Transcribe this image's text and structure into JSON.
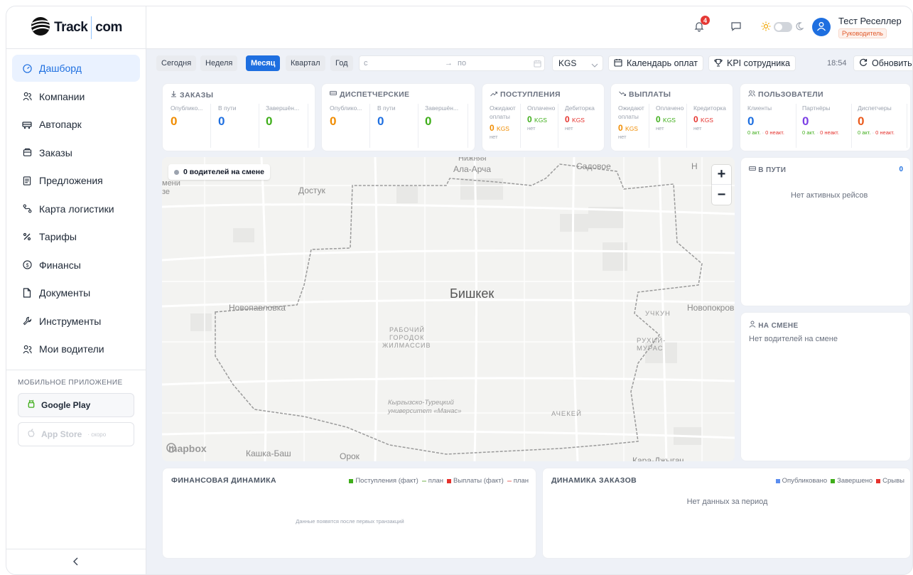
{
  "brand": {
    "logo_left": "Track",
    "logo_right": "com"
  },
  "sidebar": {
    "items": [
      {
        "label": "Дашборд",
        "icon": "gauge-icon",
        "active": true
      },
      {
        "label": "Компании",
        "icon": "users-icon",
        "active": false
      },
      {
        "label": "Автопарк",
        "icon": "truck-icon",
        "active": false
      },
      {
        "label": "Заказы",
        "icon": "box-icon",
        "active": false
      },
      {
        "label": "Предложения",
        "icon": "document-list-icon",
        "active": false
      },
      {
        "label": "Карта логистики",
        "icon": "route-icon",
        "active": false
      },
      {
        "label": "Тарифы",
        "icon": "percent-icon",
        "active": false
      },
      {
        "label": "Финансы",
        "icon": "dollar-circle-icon",
        "active": false
      },
      {
        "label": "Документы",
        "icon": "file-icon",
        "active": false
      },
      {
        "label": "Инструменты",
        "icon": "wrench-icon",
        "active": false
      },
      {
        "label": "Мои водители",
        "icon": "drivers-icon",
        "active": false
      }
    ],
    "mobile_title": "МОБИЛЬНОЕ ПРИЛОЖЕНИЕ",
    "google_play": "Google Play",
    "app_store": "App Store",
    "app_store_soon": "· скоро"
  },
  "header": {
    "notifications_count": "4",
    "user_name": "Тест Реселлер",
    "user_role": "Руководитель"
  },
  "toolbar": {
    "periods": [
      "Сегодня",
      "Неделя",
      "Месяц",
      "Квартал",
      "Год"
    ],
    "active_period": "Месяц",
    "date_from_placeholder": "с",
    "date_to_placeholder": "по",
    "arrow": "→",
    "currency": "KGS",
    "payment_calendar": "Календарь оплат",
    "kpi": "KPI сотрудника",
    "time": "18:54",
    "refresh": "Обновить"
  },
  "stats": {
    "orders": {
      "title": "ЗАКАЗЫ",
      "cols": [
        {
          "label": "Опублико...",
          "value": "0"
        },
        {
          "label": "В пути",
          "value": "0"
        },
        {
          "label": "Завершён...",
          "value": "0"
        }
      ]
    },
    "dispatch": {
      "title": "ДИСПЕТЧЕРСКИЕ",
      "cols": [
        {
          "label": "Опублико...",
          "value": "0"
        },
        {
          "label": "В пути",
          "value": "0"
        },
        {
          "label": "Завершён...",
          "value": "0"
        }
      ]
    },
    "income": {
      "title": "ПОСТУПЛЕНИЯ",
      "cols": [
        {
          "label": "Ожидают",
          "label2": "оплаты",
          "value": "0",
          "cur": "KGS",
          "sub": "нет"
        },
        {
          "label": "Оплачено",
          "value": "0",
          "cur": "KGS",
          "sub": "нет"
        },
        {
          "label": "Дебиторка",
          "value": "0",
          "cur": "KGS",
          "sub": "нет"
        }
      ]
    },
    "payouts": {
      "title": "ВЫПЛАТЫ",
      "cols": [
        {
          "label": "Ожидают",
          "label2": "оплаты",
          "value": "0",
          "cur": "KGS",
          "sub": "нет"
        },
        {
          "label": "Оплачено",
          "value": "0",
          "cur": "KGS",
          "sub": "нет"
        },
        {
          "label": "Кредиторка",
          "value": "0",
          "cur": "KGS",
          "sub": "нет"
        }
      ]
    },
    "users": {
      "title": "ПОЛЬЗОВАТЕЛИ",
      "cols": [
        {
          "label": "Клиенты",
          "value": "0",
          "active": "0 акт.",
          "sep": " · ",
          "inactive": "0 неакт."
        },
        {
          "label": "Партнёры",
          "value": "0",
          "active": "0 акт.",
          "sep": " · ",
          "inactive": "0 неакт."
        },
        {
          "label": "Диспетчеры",
          "value": "0",
          "active": "0 акт.",
          "sep": " · ",
          "inactive": "0 неакт."
        }
      ]
    }
  },
  "map": {
    "drivers_on_shift": "0 водителей на смене",
    "zoom_in": "+",
    "zoom_out": "−",
    "attribution": "mapbox",
    "labels": {
      "city": "Бишкек",
      "l1": "Нижняя",
      "l2": "Ала-Арча",
      "l3": "Садовое",
      "l4": "Н",
      "l5": "Достук",
      "l6": "мени",
      "l7": "зе",
      "l8": "Новопавловка",
      "l9": "Новопокровка",
      "l10": "УЧКУН",
      "l11": "РАБОЧИЙ",
      "l12": "ГОРОДОК",
      "l13": "ЖИЛМАССИВ",
      "l14": "РУХИЙ-",
      "l15": "МУРАС",
      "l16": "Кыргызско-Турецкий",
      "l17": "университет «Манас»",
      "l18": "АЧЕКЕЙ",
      "l19": "Кашка-Баш",
      "l20": "Орок",
      "l21": "Кара-Джыгач"
    }
  },
  "in_transit": {
    "title": "В ПУТИ",
    "count": "0",
    "empty": "Нет активных рейсов"
  },
  "on_shift": {
    "title": "НА СМЕНЕ",
    "empty": "Нет водителей на смене"
  },
  "finance_chart": {
    "title": "ФИНАНСОВАЯ ДИНАМИКА",
    "legend": [
      "Поступления (факт)",
      "план",
      "Выплаты (факт)",
      "план"
    ],
    "empty": "Данные появятся после первых транзакций"
  },
  "orders_chart": {
    "title": "ДИНАМИКА ЗАКАЗОВ",
    "legend": [
      "Опубликовано",
      "Завершено",
      "Срывы"
    ],
    "empty": "Нет данных за период"
  },
  "colors": {
    "accent": "#1e6fe0",
    "orange": "#f08c00",
    "green": "#3fae1a",
    "red": "#e5322d",
    "purple": "#7b3fe4"
  }
}
